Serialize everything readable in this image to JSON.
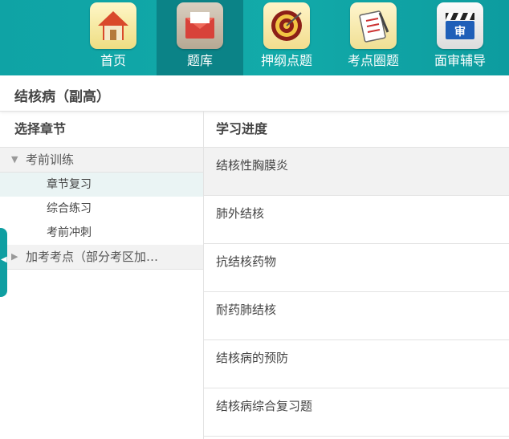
{
  "nav": {
    "items": [
      {
        "label": "首页",
        "icon": "house-icon"
      },
      {
        "label": "题库",
        "icon": "envelope-icon"
      },
      {
        "label": "押纲点题",
        "icon": "target-icon"
      },
      {
        "label": "考点圈题",
        "icon": "clipboard-icon"
      },
      {
        "label": "面审辅导",
        "icon": "clapperboard-icon"
      }
    ],
    "active_index": 1
  },
  "clapper_text": "审",
  "title": "结核病（副高）",
  "left": {
    "header": "选择章节",
    "groups": [
      {
        "label": "考前训练",
        "expanded": true,
        "items": [
          "章节复习",
          "综合练习",
          "考前冲刺"
        ]
      },
      {
        "label": "加考考点（部分考区加…",
        "expanded": false
      }
    ],
    "active_item": "章节复习"
  },
  "right": {
    "header": "学习进度",
    "chapters": [
      "结核性胸膜炎",
      "肺外结核",
      "抗结核药物",
      "耐药肺结核",
      "结核病的预防",
      "结核病综合复习题"
    ]
  },
  "colors": {
    "teal": "#12aaa9",
    "active_nav": "#0b8387",
    "side_tab": "#0f9fa2"
  }
}
